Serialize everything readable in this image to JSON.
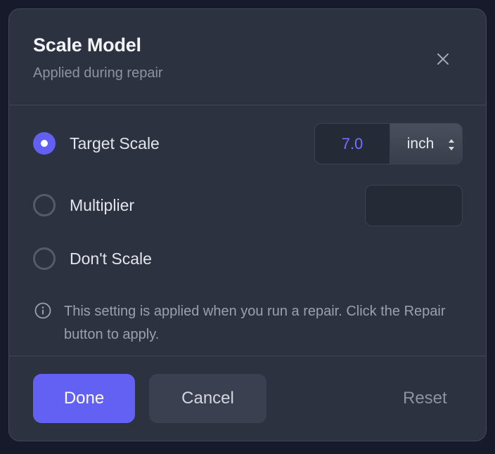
{
  "dialog": {
    "title": "Scale Model",
    "subtitle": "Applied during repair"
  },
  "options": {
    "target_scale": {
      "label": "Target Scale",
      "selected": true
    },
    "multiplier": {
      "label": "Multiplier",
      "selected": false
    },
    "dont_scale": {
      "label": "Don't Scale",
      "selected": false
    }
  },
  "target_scale_input": {
    "value": "7.0",
    "unit": "inch"
  },
  "multiplier_input": {
    "value": ""
  },
  "info": {
    "text": "This setting is applied when you run a repair. Click the Repair button to apply.",
    "icon": "info-icon"
  },
  "buttons": {
    "done": "Done",
    "cancel": "Cancel",
    "reset": "Reset"
  },
  "colors": {
    "accent": "#6261f3",
    "accent_text": "#7272ff",
    "background": "#2d3240"
  }
}
